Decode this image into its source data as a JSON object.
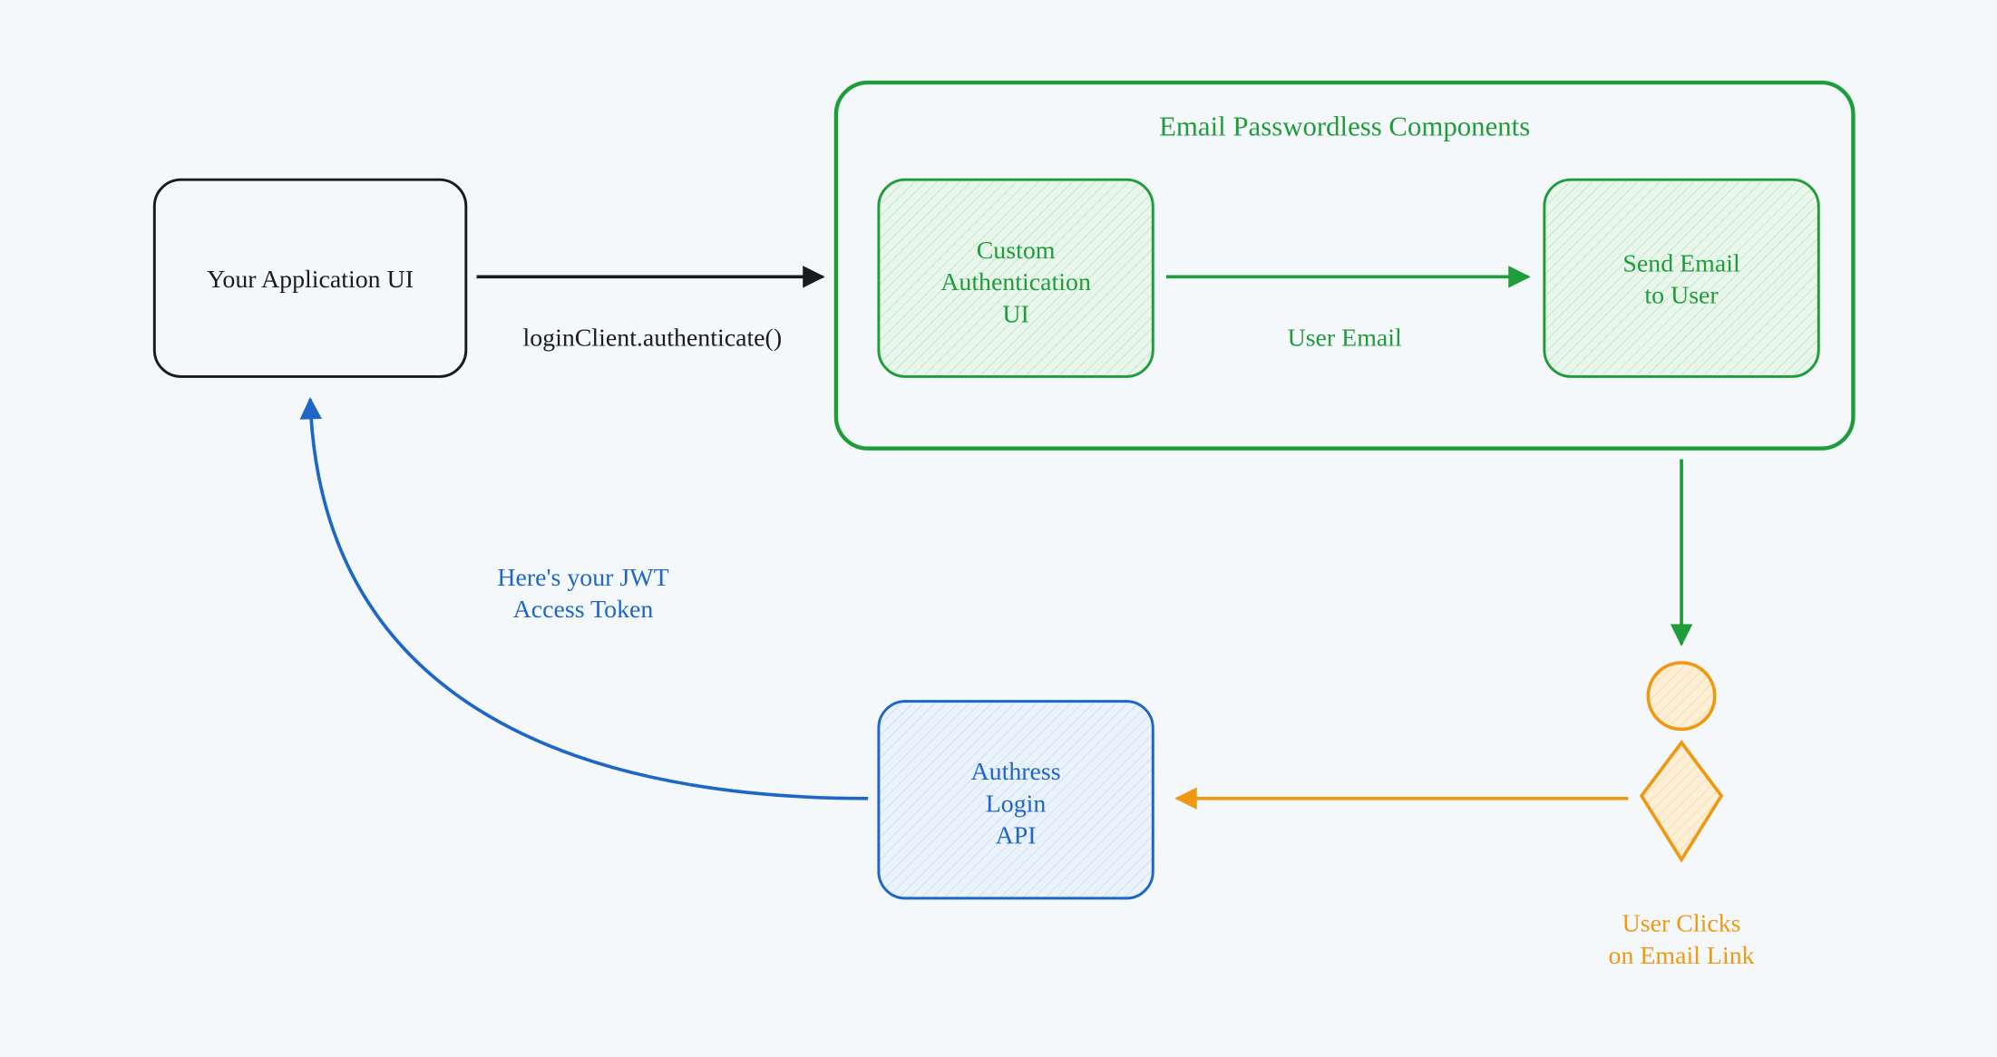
{
  "boxes": {
    "app_ui": {
      "lines": [
        "Your Application UI"
      ]
    },
    "components_title": "Email Passwordless Components",
    "custom_auth": {
      "lines": [
        "Custom",
        "Authentication",
        "UI"
      ]
    },
    "send_email": {
      "lines": [
        "Send Email",
        "to User"
      ]
    },
    "authress_api": {
      "lines": [
        "Authress",
        "Login",
        "API"
      ]
    }
  },
  "arrows": {
    "auth_call": "loginClient.authenticate()",
    "user_email": "User Email",
    "user_clicks": {
      "lines": [
        "User Clicks",
        "on Email Link"
      ]
    },
    "jwt": {
      "lines": [
        "Here's your JWT",
        "Access Token"
      ]
    }
  },
  "colors": {
    "black": "#1b1b1b",
    "green": "#1f9d3a",
    "green_fill": "#e9f6ec",
    "blue": "#1e66c7",
    "blue_fill": "#eaf2fb",
    "orange": "#ef9912",
    "orange_fill": "#fcefd6",
    "bg": "#f4f8fb"
  }
}
